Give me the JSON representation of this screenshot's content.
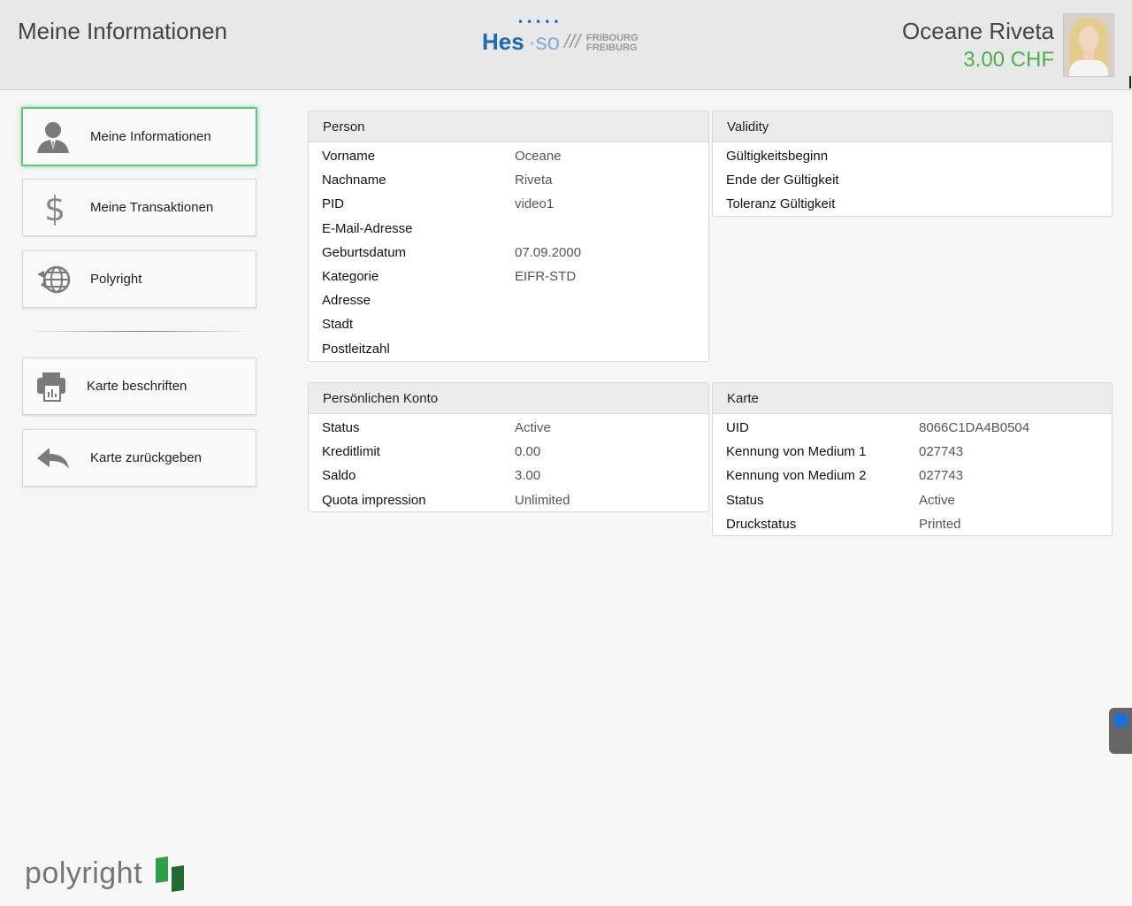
{
  "header": {
    "title": "Meine Informationen",
    "logo": {
      "dots": "•••••",
      "hes": "Hes",
      "so": "·so",
      "slashes": "///",
      "city_line1": "FRIBOURG",
      "city_line2": "FREIBURG"
    },
    "user_name": "Oceane Riveta",
    "balance": "3.00 CHF"
  },
  "nav": {
    "items": [
      {
        "label": "Meine Informationen",
        "icon": "user-icon",
        "active": true
      },
      {
        "label": "Meine Transaktionen",
        "icon": "dollar-icon",
        "active": false
      },
      {
        "label": "Polyright",
        "icon": "globe-icon",
        "active": false
      },
      {
        "label": "Karte beschriften",
        "icon": "printer-icon",
        "active": false
      },
      {
        "label": "Karte zurückgeben",
        "icon": "reply-arrow-icon",
        "active": false
      }
    ]
  },
  "panels": {
    "person": {
      "title": "Person",
      "rows": [
        {
          "key": "Vorname",
          "value": "Oceane"
        },
        {
          "key": "Nachname",
          "value": "Riveta"
        },
        {
          "key": "PID",
          "value": "video1"
        },
        {
          "key": "E-Mail-Adresse",
          "value": ""
        },
        {
          "key": "Geburtsdatum",
          "value": "07.09.2000"
        },
        {
          "key": "Kategorie",
          "value": "EIFR-STD"
        },
        {
          "key": "Adresse",
          "value": ""
        },
        {
          "key": "Stadt",
          "value": ""
        },
        {
          "key": "Postleitzahl",
          "value": ""
        }
      ]
    },
    "validity": {
      "title": "Validity",
      "rows": [
        {
          "key": "Gültigkeitsbeginn",
          "value": ""
        },
        {
          "key": "Ende der Gültigkeit",
          "value": ""
        },
        {
          "key": "Toleranz Gültigkeit",
          "value": ""
        }
      ]
    },
    "konto": {
      "title": "Persönlichen Konto",
      "rows": [
        {
          "key": "Status",
          "value": "Active"
        },
        {
          "key": "Kreditlimit",
          "value": "0.00"
        },
        {
          "key": "Saldo",
          "value": "3.00"
        },
        {
          "key": "Quota impression",
          "value": "Unlimited"
        }
      ]
    },
    "karte": {
      "title": "Karte",
      "rows": [
        {
          "key": "UID",
          "value": "8066C1DA4B0504"
        },
        {
          "key": "Kennung von Medium 1",
          "value": "027743"
        },
        {
          "key": "Kennung von Medium 2",
          "value": "027743"
        },
        {
          "key": "Status",
          "value": "Active"
        },
        {
          "key": "Druckstatus",
          "value": "Printed"
        }
      ]
    }
  },
  "footer": {
    "brand": "polyright"
  },
  "colors": {
    "accent_green": "#4cae4c",
    "brand_blue": "#1c69b5",
    "logo_green": "#2e9e47"
  }
}
